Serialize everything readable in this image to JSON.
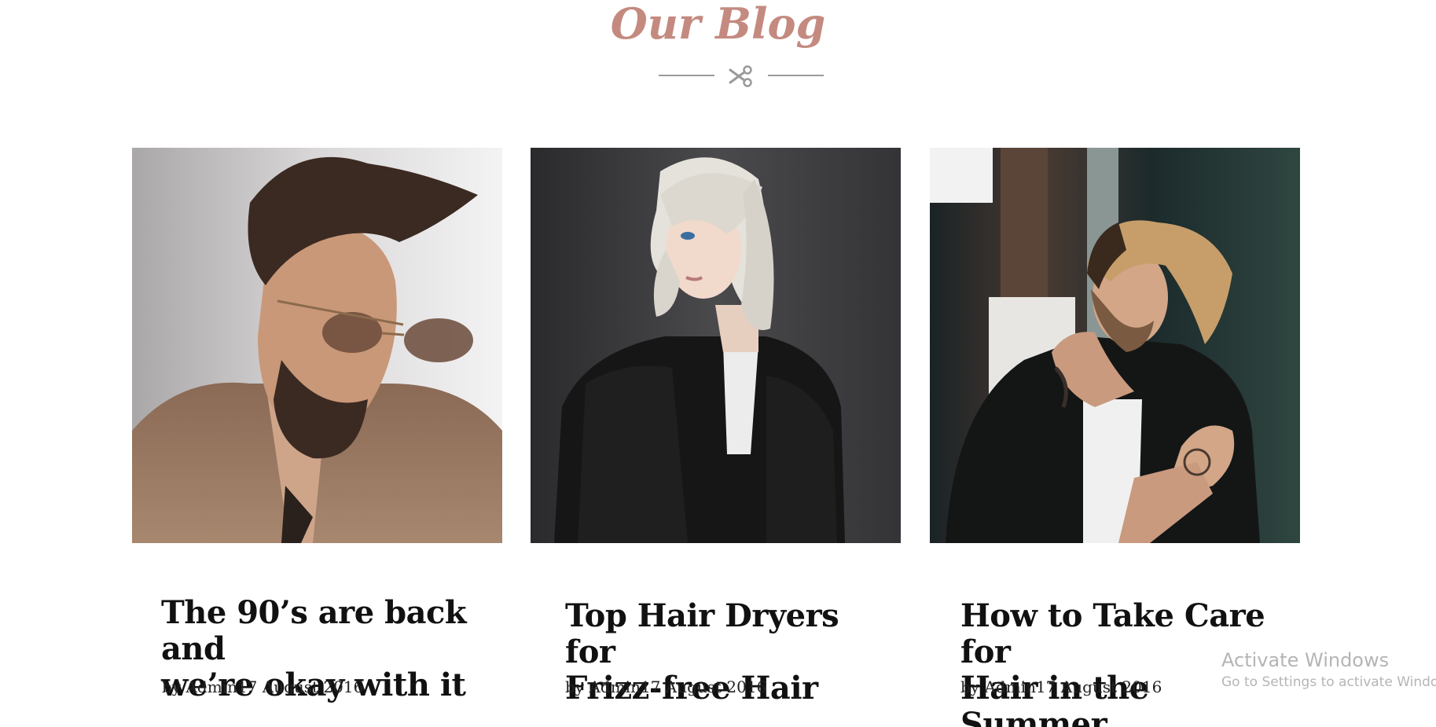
{
  "section": {
    "title": "Our Blog"
  },
  "posts": [
    {
      "title_line1": "The 90’s are back and",
      "title_line2": "we’re okay with it",
      "author": "by Admin",
      "date": "17 August 2016"
    },
    {
      "title_line1": "Top Hair Dryers for",
      "title_line2": "Frizz-free Hair",
      "author": "by Admin",
      "date": "17 August 2016"
    },
    {
      "title_line1": "How to Take Care for",
      "title_line2": "Hair in the Summer",
      "author": "by Admin",
      "date": "17 August 2016"
    }
  ],
  "watermark": {
    "title": "Activate Windows",
    "subtitle": "Go to Settings to activate Windows."
  },
  "colors": {
    "accent": "#c48a80",
    "divider": "#9a9a9a",
    "heading": "#111111"
  }
}
